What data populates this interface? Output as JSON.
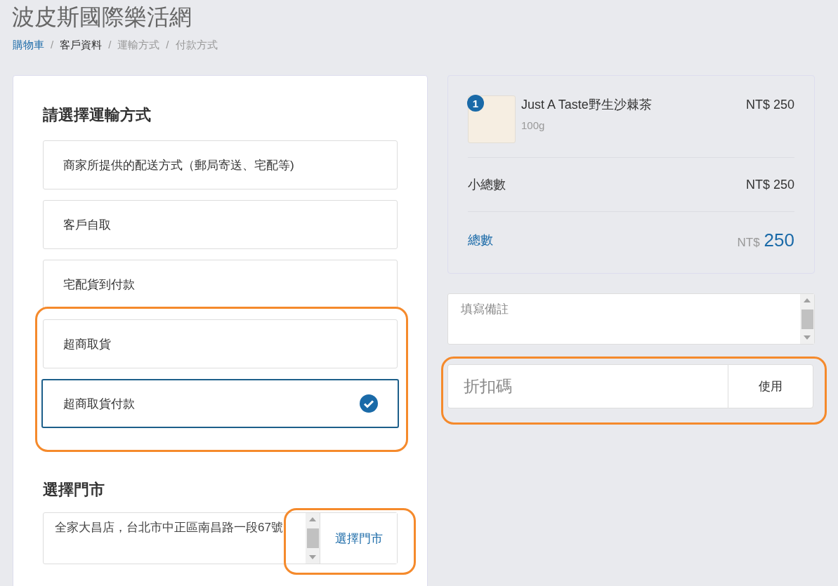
{
  "site_title": "波皮斯國際樂活網",
  "breadcrumb": {
    "separator": "/",
    "items": [
      {
        "label": "購物車",
        "kind": "link"
      },
      {
        "label": "客戶資料",
        "kind": "current"
      },
      {
        "label": "運輸方式",
        "kind": "upcoming"
      },
      {
        "label": "付款方式",
        "kind": "upcoming"
      }
    ]
  },
  "shipping": {
    "heading": "請選擇運輸方式",
    "options": [
      {
        "label": "商家所提供的配送方式（郵局寄送、宅配等)",
        "selected": false
      },
      {
        "label": "客戶自取",
        "selected": false
      },
      {
        "label": "宅配貨到付款",
        "selected": false
      },
      {
        "label": "超商取貨",
        "selected": false
      },
      {
        "label": "超商取貨付款",
        "selected": true
      }
    ]
  },
  "store": {
    "heading": "選擇門市",
    "value": "全家大昌店，台北市中正區南昌路一段67號",
    "button": "選擇門市"
  },
  "cart": {
    "items": [
      {
        "quantity": "1",
        "name": "Just A Taste野生沙棘茶",
        "variant": "100g",
        "price": "NT$ 250"
      }
    ],
    "subtotal": {
      "label": "小總數",
      "value": "NT$ 250"
    },
    "total": {
      "label": "總數",
      "currency": "NT$",
      "amount": "250"
    }
  },
  "note": {
    "placeholder": "填寫備註"
  },
  "discount": {
    "placeholder": "折扣碼",
    "button": "使用"
  }
}
